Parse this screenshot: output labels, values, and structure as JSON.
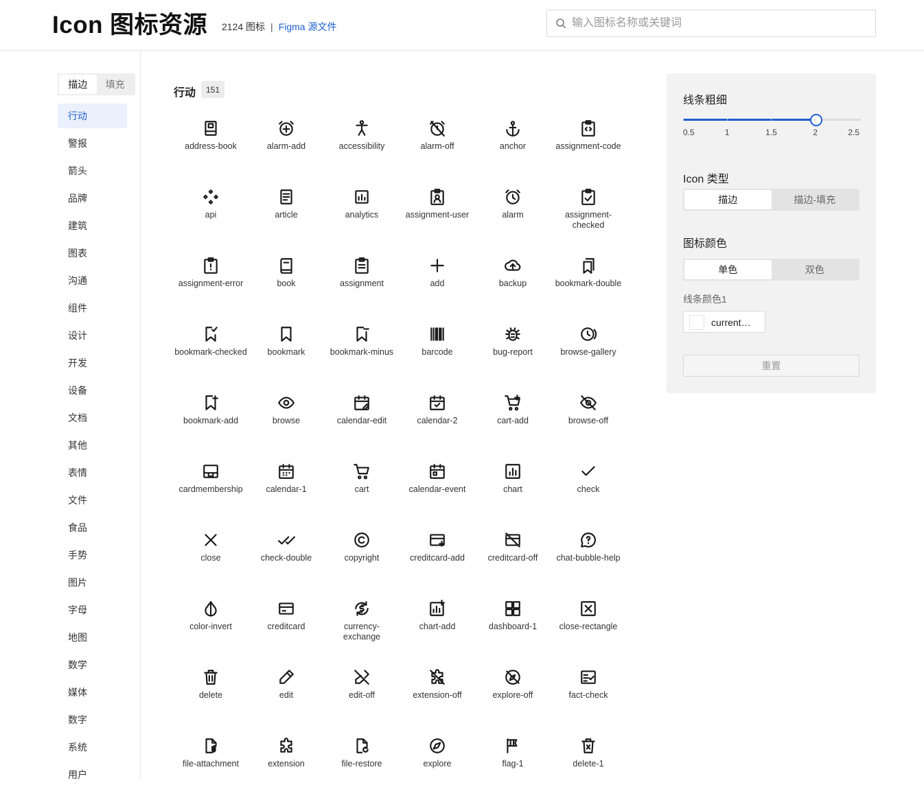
{
  "header": {
    "title": "Icon 图标资源",
    "icon_count": "2124 图标",
    "separator": "|",
    "figma_link": "Figma 源文件"
  },
  "search": {
    "placeholder": "输入图标名称或关键词",
    "value": ""
  },
  "sidebar": {
    "style_toggle": [
      {
        "label": "描边",
        "active": true
      },
      {
        "label": "填充",
        "active": false
      }
    ],
    "categories": [
      {
        "label": "行动",
        "active": true
      },
      {
        "label": "警报"
      },
      {
        "label": "箭头"
      },
      {
        "label": "品牌"
      },
      {
        "label": "建筑"
      },
      {
        "label": "图表"
      },
      {
        "label": "沟通"
      },
      {
        "label": "组件"
      },
      {
        "label": "设计"
      },
      {
        "label": "开发"
      },
      {
        "label": "设备"
      },
      {
        "label": "文档"
      },
      {
        "label": "其他"
      },
      {
        "label": "表情"
      },
      {
        "label": "文件"
      },
      {
        "label": "食品"
      },
      {
        "label": "手势"
      },
      {
        "label": "图片"
      },
      {
        "label": "字母"
      },
      {
        "label": "地图"
      },
      {
        "label": "数学"
      },
      {
        "label": "媒体"
      },
      {
        "label": "数字"
      },
      {
        "label": "系统"
      },
      {
        "label": "用户"
      }
    ]
  },
  "main": {
    "section_title": "行动",
    "section_count": "151",
    "icons": [
      "address-book",
      "alarm-add",
      "accessibility",
      "alarm-off",
      "anchor",
      "assignment-code",
      "api",
      "article",
      "analytics",
      "assignment-user",
      "alarm",
      "assignment-checked",
      "assignment-error",
      "book",
      "assignment",
      "add",
      "backup",
      "bookmark-double",
      "bookmark-checked",
      "bookmark",
      "bookmark-minus",
      "barcode",
      "bug-report",
      "browse-gallery",
      "bookmark-add",
      "browse",
      "calendar-edit",
      "calendar-2",
      "cart-add",
      "browse-off",
      "cardmembership",
      "calendar-1",
      "cart",
      "calendar-event",
      "chart",
      "check",
      "close",
      "check-double",
      "copyright",
      "creditcard-add",
      "creditcard-off",
      "chat-bubble-help",
      "color-invert",
      "creditcard",
      "currency-exchange",
      "chart-add",
      "dashboard-1",
      "close-rectangle",
      "delete",
      "edit",
      "edit-off",
      "extension-off",
      "explore-off",
      "fact-check",
      "file-attachment",
      "extension",
      "file-restore",
      "explore",
      "flag-1",
      "delete-1"
    ]
  },
  "panel": {
    "stroke_title": "线条粗细",
    "stroke_value": 2,
    "stroke_range": [
      0.5,
      2.5
    ],
    "stroke_ticks": [
      "0.5",
      "1",
      "1.5",
      "2",
      "2.5"
    ],
    "type_title": "Icon 类型",
    "type_options": [
      {
        "label": "描边",
        "active": true
      },
      {
        "label": "描边-填充",
        "active": false
      }
    ],
    "color_title": "图标颜色",
    "color_options": [
      {
        "label": "单色",
        "active": true
      },
      {
        "label": "双色",
        "active": false
      }
    ],
    "stroke_color_label": "线条颜色1",
    "stroke_color_value": "current…",
    "reset_label": "重置"
  },
  "colors": {
    "accent": "#1f5fd1",
    "active_bg": "#ebf0fd",
    "panel_bg": "#f2f2f2"
  }
}
